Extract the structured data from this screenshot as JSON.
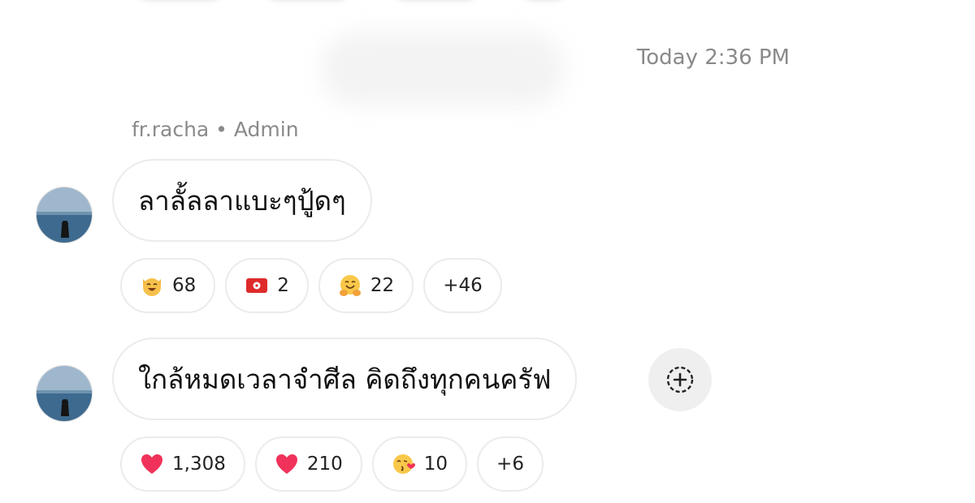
{
  "timestamp": "Today 2:36 PM",
  "sender": "fr.racha • Admin",
  "messages": [
    {
      "text": "ลาลั้ลลาแบะๆปู้ดๆ",
      "reactions": [
        {
          "emoji": "smiling-cat-face",
          "count": "68"
        },
        {
          "emoji": "hong-kong-flag",
          "count": "2"
        },
        {
          "emoji": "hugging-face",
          "count": "22"
        }
      ],
      "more": "+46"
    },
    {
      "text": "ใกล้หมดเวลาจำศีล คิดถึงทุกคนครัฟ",
      "reactions": [
        {
          "emoji": "red-heart",
          "count": "1,308"
        },
        {
          "emoji": "red-heart",
          "count": "210"
        },
        {
          "emoji": "face-blowing-kiss",
          "count": "10"
        }
      ],
      "more": "+6"
    }
  ],
  "colors": {
    "secondary_text": "#8a8a8a",
    "bubble_border": "#ebebeb",
    "react_button_bg": "#efefef"
  }
}
